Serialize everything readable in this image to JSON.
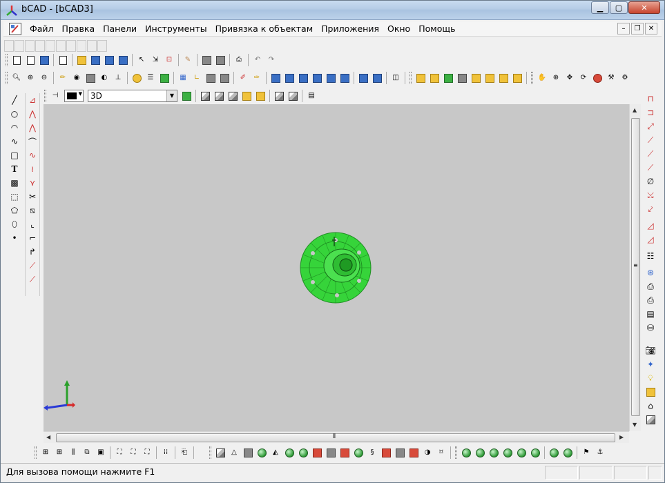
{
  "window": {
    "title": "bCAD - [bCAD3]"
  },
  "menu": {
    "items": [
      "Файл",
      "Правка",
      "Панели",
      "Инструменты",
      "Привязка к объектам",
      "Приложения",
      "Окно",
      "Помощь"
    ]
  },
  "view_toolbar": {
    "view_mode": "3D",
    "current_color": "#000000"
  },
  "colors": {
    "canvas_bg": "#c8c8c8",
    "model_green": "#36d43a",
    "axis_x": "#d62a2a",
    "axis_y": "#2aa02a",
    "axis_z": "#2a3ad6"
  },
  "statusbar": {
    "help_text": "Для вызова помощи нажмите F1"
  }
}
